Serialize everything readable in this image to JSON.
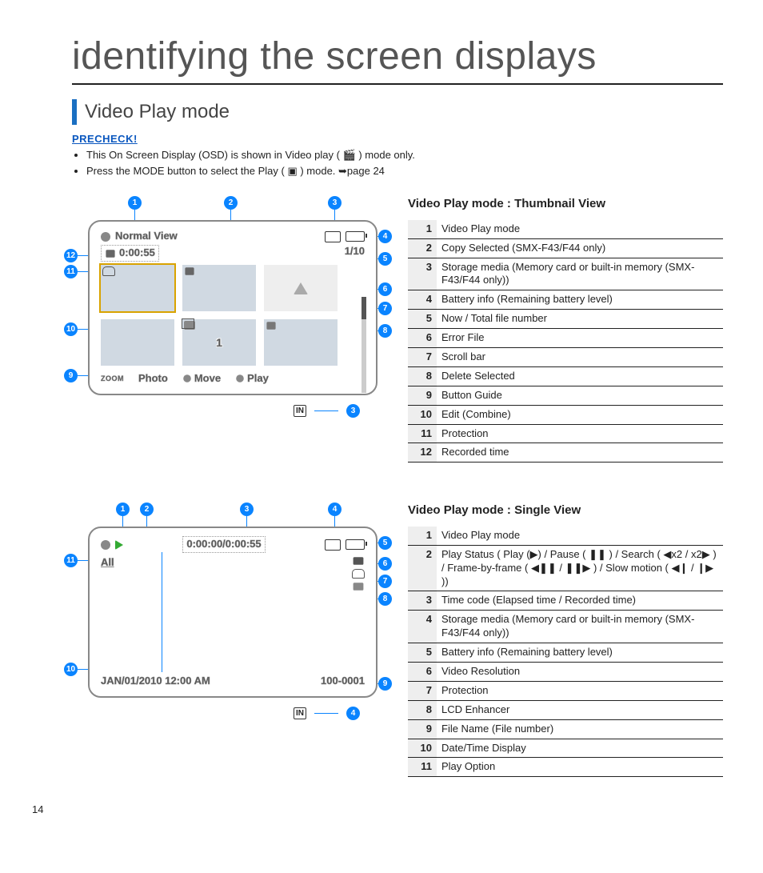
{
  "page": {
    "title": "identifying the screen displays",
    "section": "Video Play mode",
    "precheck_label": "PRECHECK!",
    "precheck": [
      "This On Screen Display (OSD) is shown in Video play ( 🎬 ) mode only.",
      "Press the MODE button to select the Play ( ▣ ) mode. ➥page 24"
    ],
    "page_number": "14"
  },
  "thumbnail": {
    "title": "Video Play mode : Thumbnail View",
    "osd": {
      "title_label": "Normal View",
      "rec_time": "0:00:55",
      "counter": "1/10",
      "guide_photo": "Photo",
      "guide_move": "Move",
      "guide_play": "Play",
      "zoom_label": "ZOOM",
      "combine_badge": "1",
      "in_label": "IN"
    },
    "legend": [
      {
        "n": "1",
        "t": "Video Play mode"
      },
      {
        "n": "2",
        "t": "Copy Selected (SMX-F43/F44 only)"
      },
      {
        "n": "3",
        "t": "Storage media (Memory card or built-in memory (SMX-F43/F44 only))"
      },
      {
        "n": "4",
        "t": "Battery info (Remaining battery level)"
      },
      {
        "n": "5",
        "t": "Now / Total file number"
      },
      {
        "n": "6",
        "t": "Error File"
      },
      {
        "n": "7",
        "t": "Scroll bar"
      },
      {
        "n": "8",
        "t": "Delete Selected"
      },
      {
        "n": "9",
        "t": "Button Guide"
      },
      {
        "n": "10",
        "t": "Edit (Combine)"
      },
      {
        "n": "11",
        "t": "Protection"
      },
      {
        "n": "12",
        "t": "Recorded time"
      }
    ]
  },
  "single": {
    "title": "Video Play mode : Single View",
    "osd": {
      "timecode": "0:00:00/0:00:55",
      "play_option": "All",
      "datetime": "JAN/01/2010 12:00 AM",
      "filename": "100-0001",
      "in_label": "IN"
    },
    "legend": [
      {
        "n": "1",
        "t": "Video Play mode"
      },
      {
        "n": "2",
        "t": "Play Status ( Play (▶) / Pause ( ❚❚ ) / Search ( ◀x2 / x2▶ ) / Frame-by-frame ( ◀❚❚ / ❚❚▶ ) / Slow motion ( ◀❙ / ❙▶ ))"
      },
      {
        "n": "3",
        "t": "Time code (Elapsed time / Recorded time)"
      },
      {
        "n": "4",
        "t": "Storage media (Memory card or built-in memory (SMX-F43/F44 only))"
      },
      {
        "n": "5",
        "t": "Battery info (Remaining battery level)"
      },
      {
        "n": "6",
        "t": "Video Resolution"
      },
      {
        "n": "7",
        "t": "Protection"
      },
      {
        "n": "8",
        "t": "LCD Enhancer"
      },
      {
        "n": "9",
        "t": "File Name (File number)"
      },
      {
        "n": "10",
        "t": "Date/Time Display"
      },
      {
        "n": "11",
        "t": "Play Option"
      }
    ]
  }
}
